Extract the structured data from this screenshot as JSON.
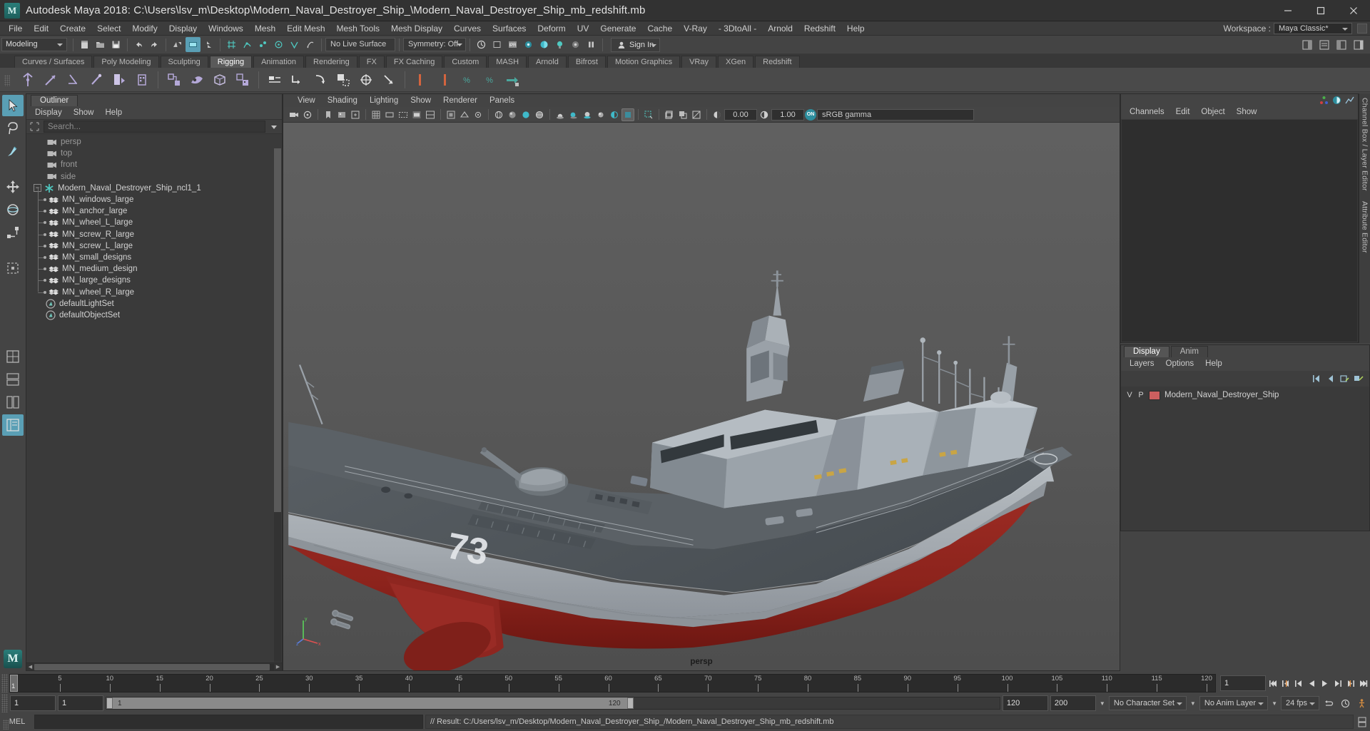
{
  "window": {
    "title": "Autodesk Maya 2018: C:\\Users\\lsv_m\\Desktop\\Modern_Naval_Destroyer_Ship_\\Modern_Naval_Destroyer_Ship_mb_redshift.mb",
    "minimize": "—",
    "maximize": "❐",
    "close": "✕"
  },
  "menubar": {
    "items": [
      "File",
      "Edit",
      "Create",
      "Select",
      "Modify",
      "Display",
      "Windows",
      "Mesh",
      "Edit Mesh",
      "Mesh Tools",
      "Mesh Display",
      "Curves",
      "Surfaces",
      "Deform",
      "UV",
      "Generate",
      "Cache",
      "V-Ray",
      "- 3DtoAll -",
      "Arnold",
      "Redshift",
      "Help"
    ],
    "workspace_label": "Workspace :",
    "workspace_value": "Maya Classic*"
  },
  "statusbar": {
    "mode": "Modeling",
    "live_surface": "No Live Surface",
    "symmetry": "Symmetry: Off",
    "signin": "Sign In"
  },
  "shelf": {
    "tabs": [
      "Curves / Surfaces",
      "Poly Modeling",
      "Sculpting",
      "Rigging",
      "Animation",
      "Rendering",
      "FX",
      "FX Caching",
      "Custom",
      "MASH",
      "Arnold",
      "Bifrost",
      "Motion Graphics",
      "VRay",
      "XGen",
      "Redshift"
    ],
    "active_tab": "Rigging"
  },
  "outliner": {
    "tab": "Outliner",
    "menus": [
      "Display",
      "Show",
      "Help"
    ],
    "search_placeholder": "Search...",
    "search_value": "",
    "items": [
      {
        "label": "persp",
        "icon": "camera-icon",
        "depth": 1,
        "dim": true,
        "kind": "camera"
      },
      {
        "label": "top",
        "icon": "camera-icon",
        "depth": 1,
        "dim": true,
        "kind": "camera"
      },
      {
        "label": "front",
        "icon": "camera-icon",
        "depth": 1,
        "dim": true,
        "kind": "camera"
      },
      {
        "label": "side",
        "icon": "camera-icon",
        "depth": 1,
        "dim": true,
        "kind": "camera"
      },
      {
        "label": "Modern_Naval_Destroyer_Ship_ncl1_1",
        "icon": "asterisk-icon",
        "depth": 0,
        "dim": false,
        "kind": "group",
        "expanded": true
      },
      {
        "label": "MN_windows_large",
        "icon": "mesh-icon",
        "depth": 1,
        "dim": false,
        "kind": "mesh"
      },
      {
        "label": "MN_anchor_large",
        "icon": "mesh-icon",
        "depth": 1,
        "dim": false,
        "kind": "mesh"
      },
      {
        "label": "MN_wheel_L_large",
        "icon": "mesh-icon",
        "depth": 1,
        "dim": false,
        "kind": "mesh"
      },
      {
        "label": "MN_screw_R_large",
        "icon": "mesh-icon",
        "depth": 1,
        "dim": false,
        "kind": "mesh"
      },
      {
        "label": "MN_screw_L_large",
        "icon": "mesh-icon",
        "depth": 1,
        "dim": false,
        "kind": "mesh"
      },
      {
        "label": "MN_small_designs",
        "icon": "mesh-icon",
        "depth": 1,
        "dim": false,
        "kind": "mesh"
      },
      {
        "label": "MN_medium_design",
        "icon": "mesh-icon",
        "depth": 1,
        "dim": false,
        "kind": "mesh"
      },
      {
        "label": "MN_large_designs",
        "icon": "mesh-icon",
        "depth": 1,
        "dim": false,
        "kind": "mesh"
      },
      {
        "label": "MN_wheel_R_large",
        "icon": "mesh-icon",
        "depth": 1,
        "dim": false,
        "kind": "mesh",
        "last": true
      },
      {
        "label": "defaultLightSet",
        "icon": "set-icon",
        "depth": 1,
        "dim": false,
        "kind": "set"
      },
      {
        "label": "defaultObjectSet",
        "icon": "set-icon",
        "depth": 1,
        "dim": false,
        "kind": "set"
      }
    ]
  },
  "viewport": {
    "menus": [
      "View",
      "Shading",
      "Lighting",
      "Show",
      "Renderer",
      "Panels"
    ],
    "exposure": "0.00",
    "gamma": "1.00",
    "color_profile": "sRGB gamma",
    "toggle_state": "ON",
    "camera_label": "persp",
    "hull_number": "73",
    "axis": {
      "x": "x",
      "y": "y",
      "z": "z"
    }
  },
  "channelbox": {
    "menus": [
      "Channels",
      "Edit",
      "Object",
      "Show"
    ],
    "vertical_tabs": [
      "Channel Box / Layer Editor",
      "Attribute Editor"
    ]
  },
  "layer_editor": {
    "tabs": [
      "Display",
      "Anim"
    ],
    "active_tab": "Display",
    "menus": [
      "Layers",
      "Options",
      "Help"
    ],
    "column_v": "V",
    "column_p": "P",
    "layers": [
      {
        "v": "V",
        "p": "P",
        "color": "#cc5f5f",
        "name": "Modern_Naval_Destroyer_Ship"
      }
    ]
  },
  "timeslider": {
    "current_frame": "1",
    "current_frame_field": "1",
    "ticks": [
      {
        "label": "5",
        "frame": 5
      },
      {
        "label": "10",
        "frame": 10
      },
      {
        "label": "15",
        "frame": 15
      },
      {
        "label": "20",
        "frame": 20
      },
      {
        "label": "25",
        "frame": 25
      },
      {
        "label": "30",
        "frame": 30
      },
      {
        "label": "35",
        "frame": 35
      },
      {
        "label": "40",
        "frame": 40
      },
      {
        "label": "45",
        "frame": 45
      },
      {
        "label": "50",
        "frame": 50
      },
      {
        "label": "55",
        "frame": 55
      },
      {
        "label": "60",
        "frame": 60
      },
      {
        "label": "65",
        "frame": 65
      },
      {
        "label": "70",
        "frame": 70
      },
      {
        "label": "75",
        "frame": 75
      },
      {
        "label": "80",
        "frame": 80
      },
      {
        "label": "85",
        "frame": 85
      },
      {
        "label": "90",
        "frame": 90
      },
      {
        "label": "95",
        "frame": 95
      },
      {
        "label": "100",
        "frame": 100
      },
      {
        "label": "105",
        "frame": 105
      },
      {
        "label": "110",
        "frame": 110
      },
      {
        "label": "115",
        "frame": 115
      },
      {
        "label": "120",
        "frame": 120
      }
    ]
  },
  "rangebar": {
    "anim_start": "1",
    "range_start": "1",
    "bar_start": "1",
    "bar_end": "120",
    "range_end": "120",
    "anim_end": "200",
    "character_set": "No Character Set",
    "anim_layer": "No Anim Layer",
    "fps": "24 fps"
  },
  "commandline": {
    "mel_label": "MEL",
    "input_value": "",
    "result": "// Result: C:/Users/lsv_m/Desktop/Modern_Naval_Destroyer_Ship_/Modern_Naval_Destroyer_Ship_mb_redshift.mb"
  },
  "colors": {
    "accent_teal": "#2d8e9e",
    "highlight_blue": "#5a9fb5",
    "shelf_purple": "#b4a8d8",
    "layer_red": "#cc5f5f",
    "hull_red": "#8e2020",
    "hull_grey": "#9aa0a4"
  }
}
